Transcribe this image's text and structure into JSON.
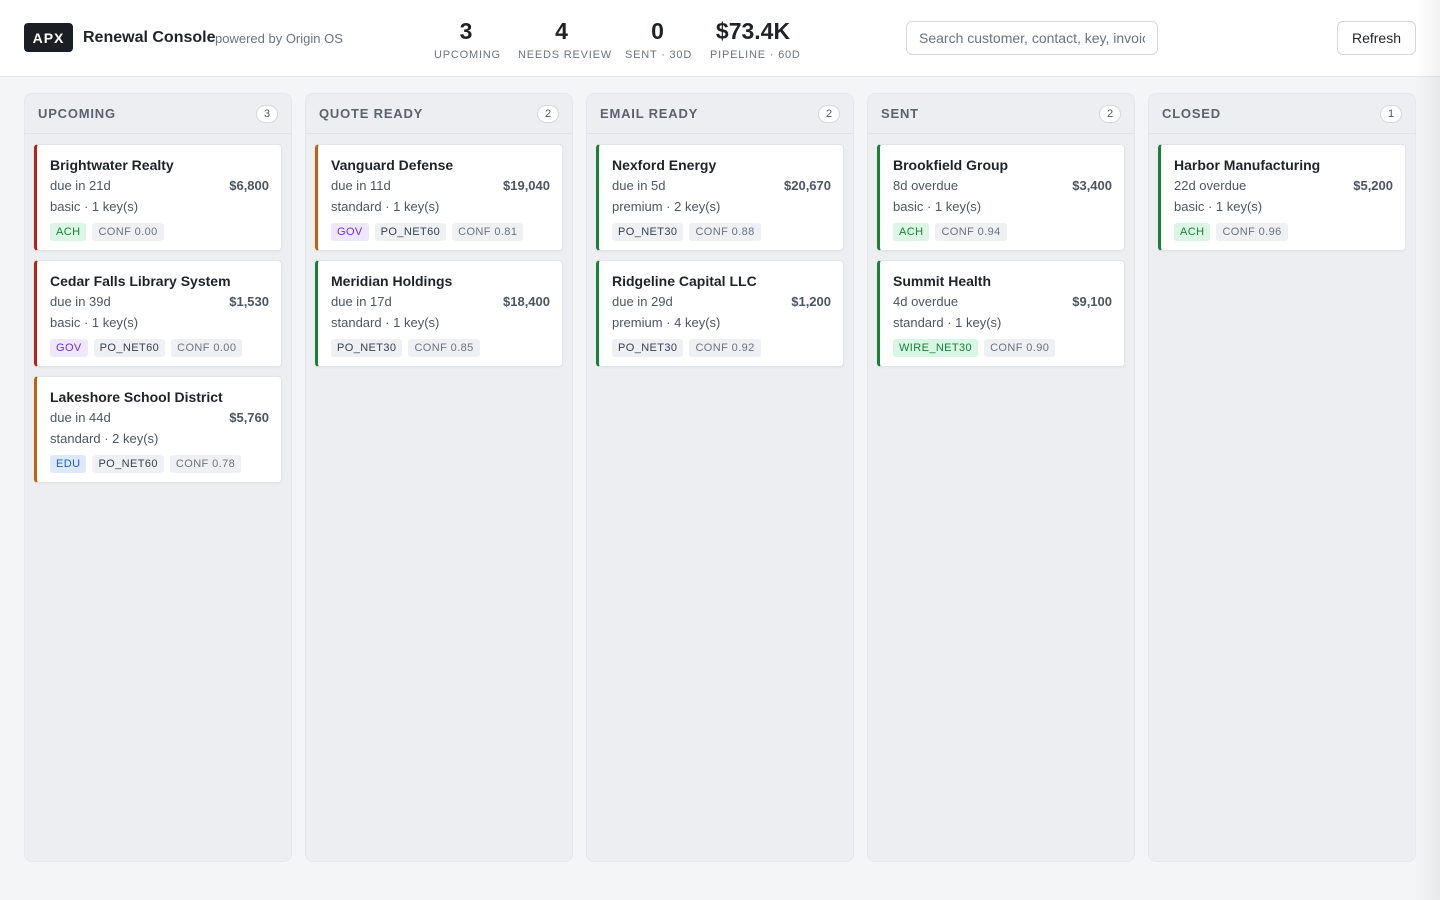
{
  "header": {
    "logo": "APX",
    "title": "Renewal Console",
    "subtitle": "powered by Origin OS",
    "stats": [
      {
        "value": "3",
        "label": "UPCOMING"
      },
      {
        "value": "4",
        "label": "NEEDS REVIEW"
      },
      {
        "value": "0",
        "label": "SENT · 30D"
      },
      {
        "value": "$73.4K",
        "label": "PIPELINE · 60D"
      }
    ],
    "search_placeholder": "Search customer, contact, key, invoice",
    "refresh_label": "Refresh"
  },
  "columns": [
    {
      "title": "UPCOMING",
      "count": "3",
      "cards": [
        {
          "name": "Brightwater Realty",
          "due": "due in 21d",
          "amount": "$6,800",
          "plan": "basic · 1 key(s)",
          "accent": "red",
          "tags": [
            {
              "text": "ACH",
              "kind": "ach"
            },
            {
              "text": "CONF 0.00",
              "kind": "conf"
            }
          ]
        },
        {
          "name": "Cedar Falls Library System",
          "due": "due in 39d",
          "amount": "$1,530",
          "plan": "basic · 1 key(s)",
          "accent": "red",
          "tags": [
            {
              "text": "GOV",
              "kind": "gov"
            },
            {
              "text": "PO_NET60",
              "kind": "plain"
            },
            {
              "text": "CONF 0.00",
              "kind": "conf"
            }
          ]
        },
        {
          "name": "Lakeshore School District",
          "due": "due in 44d",
          "amount": "$5,760",
          "plan": "standard · 2 key(s)",
          "accent": "amber",
          "tags": [
            {
              "text": "EDU",
              "kind": "edu"
            },
            {
              "text": "PO_NET60",
              "kind": "plain"
            },
            {
              "text": "CONF 0.78",
              "kind": "conf"
            }
          ]
        }
      ]
    },
    {
      "title": "QUOTE READY",
      "count": "2",
      "cards": [
        {
          "name": "Vanguard Defense",
          "due": "due in 11d",
          "amount": "$19,040",
          "plan": "standard · 1 key(s)",
          "accent": "amber",
          "tags": [
            {
              "text": "GOV",
              "kind": "gov"
            },
            {
              "text": "PO_NET60",
              "kind": "plain"
            },
            {
              "text": "CONF 0.81",
              "kind": "conf"
            }
          ]
        },
        {
          "name": "Meridian Holdings",
          "due": "due in 17d",
          "amount": "$18,400",
          "plan": "standard · 1 key(s)",
          "accent": "green",
          "tags": [
            {
              "text": "PO_NET30",
              "kind": "plain"
            },
            {
              "text": "CONF 0.85",
              "kind": "conf"
            }
          ]
        }
      ]
    },
    {
      "title": "EMAIL READY",
      "count": "2",
      "cards": [
        {
          "name": "Nexford Energy",
          "due": "due in 5d",
          "amount": "$20,670",
          "plan": "premium · 2 key(s)",
          "accent": "green",
          "tags": [
            {
              "text": "PO_NET30",
              "kind": "plain"
            },
            {
              "text": "CONF 0.88",
              "kind": "conf"
            }
          ]
        },
        {
          "name": "Ridgeline Capital LLC",
          "due": "due in 29d",
          "amount": "$1,200",
          "plan": "premium · 4 key(s)",
          "accent": "green",
          "tags": [
            {
              "text": "PO_NET30",
              "kind": "plain"
            },
            {
              "text": "CONF 0.92",
              "kind": "conf"
            }
          ]
        }
      ]
    },
    {
      "title": "SENT",
      "count": "2",
      "cards": [
        {
          "name": "Brookfield Group",
          "due": "8d overdue",
          "amount": "$3,400",
          "plan": "basic · 1 key(s)",
          "accent": "green",
          "tags": [
            {
              "text": "ACH",
              "kind": "ach"
            },
            {
              "text": "CONF 0.94",
              "kind": "conf"
            }
          ]
        },
        {
          "name": "Summit Health",
          "due": "4d overdue",
          "amount": "$9,100",
          "plan": "standard · 1 key(s)",
          "accent": "green",
          "tags": [
            {
              "text": "WIRE_NET30",
              "kind": "wire"
            },
            {
              "text": "CONF 0.90",
              "kind": "conf"
            }
          ]
        }
      ]
    },
    {
      "title": "CLOSED",
      "count": "1",
      "cards": [
        {
          "name": "Harbor Manufacturing",
          "due": "22d overdue",
          "amount": "$5,200",
          "plan": "basic · 1 key(s)",
          "accent": "green",
          "tags": [
            {
              "text": "ACH",
              "kind": "ach"
            },
            {
              "text": "CONF 0.96",
              "kind": "conf"
            }
          ]
        }
      ]
    }
  ]
}
